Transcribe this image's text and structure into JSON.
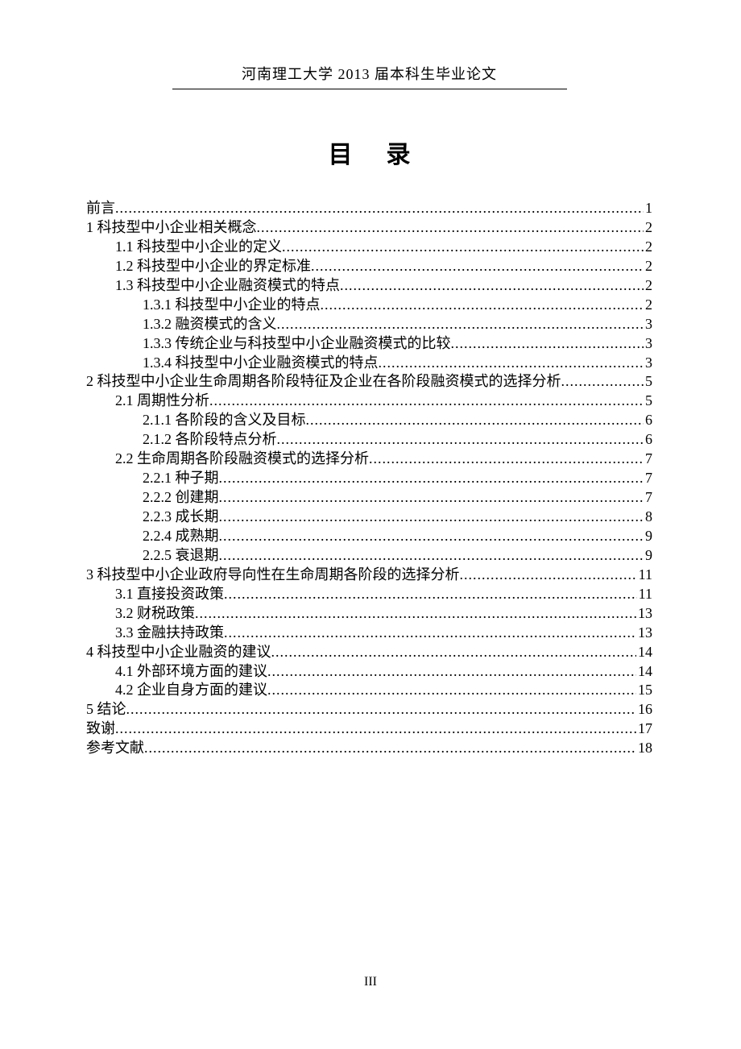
{
  "header": "河南理工大学 2013 届本科生毕业论文",
  "toc_title": "目录",
  "page_number": "III",
  "entries": [
    {
      "indent": 0,
      "label": "前言",
      "page": "1"
    },
    {
      "indent": 0,
      "label": "1 科技型中小企业相关概念",
      "page": "2"
    },
    {
      "indent": 1,
      "label": "1.1 科技型中小企业的定义",
      "page": "2"
    },
    {
      "indent": 1,
      "label": "1.2 科技型中小企业的界定标准",
      "page": "2"
    },
    {
      "indent": 1,
      "label": "1.3 科技型中小企业融资模式的特点",
      "page": "2"
    },
    {
      "indent": 2,
      "label": "1.3.1 科技型中小企业的特点",
      "page": "2"
    },
    {
      "indent": 2,
      "label": "1.3.2 融资模式的含义",
      "page": "3"
    },
    {
      "indent": 2,
      "label": "1.3.3 传统企业与科技型中小企业融资模式的比较",
      "page": "3"
    },
    {
      "indent": 2,
      "label": "1.3.4 科技型中小企业融资模式的特点",
      "page": "3"
    },
    {
      "indent": 0,
      "label": "2 科技型中小企业生命周期各阶段特征及企业在各阶段融资模式的选择分析",
      "page": "5"
    },
    {
      "indent": 1,
      "label": "2.1 周期性分析",
      "page": "5"
    },
    {
      "indent": 2,
      "label": "2.1.1 各阶段的含义及目标",
      "page": "6"
    },
    {
      "indent": 2,
      "label": "2.1.2 各阶段特点分析",
      "page": "6"
    },
    {
      "indent": 1,
      "label": "2.2 生命周期各阶段融资模式的选择分析",
      "page": "7"
    },
    {
      "indent": 2,
      "label": "2.2.1 种子期",
      "page": "7"
    },
    {
      "indent": 2,
      "label": "2.2.2 创建期",
      "page": "7"
    },
    {
      "indent": 2,
      "label": "2.2.3 成长期",
      "page": "8"
    },
    {
      "indent": 2,
      "label": "2.2.4 成熟期",
      "page": "9"
    },
    {
      "indent": 2,
      "label": "2.2.5 衰退期",
      "page": "9"
    },
    {
      "indent": 0,
      "label": "3 科技型中小企业政府导向性在生命周期各阶段的选择分析",
      "page": "11"
    },
    {
      "indent": 1,
      "label": "3.1 直接投资政策",
      "page": "11"
    },
    {
      "indent": 1,
      "label": "3.2 财税政策",
      "page": "13"
    },
    {
      "indent": 1,
      "label": "3.3 金融扶持政策",
      "page": "13"
    },
    {
      "indent": 0,
      "label": "4 科技型中小企业融资的建议",
      "page": "14"
    },
    {
      "indent": 1,
      "label": "4.1 外部环境方面的建议",
      "page": "14"
    },
    {
      "indent": 1,
      "label": "4.2 企业自身方面的建议",
      "page": "15"
    },
    {
      "indent": 0,
      "label": "5 结论",
      "page": "16"
    },
    {
      "indent": 0,
      "label": "致谢",
      "page": "17"
    },
    {
      "indent": 0,
      "label": "参考文献",
      "page": "18"
    }
  ]
}
